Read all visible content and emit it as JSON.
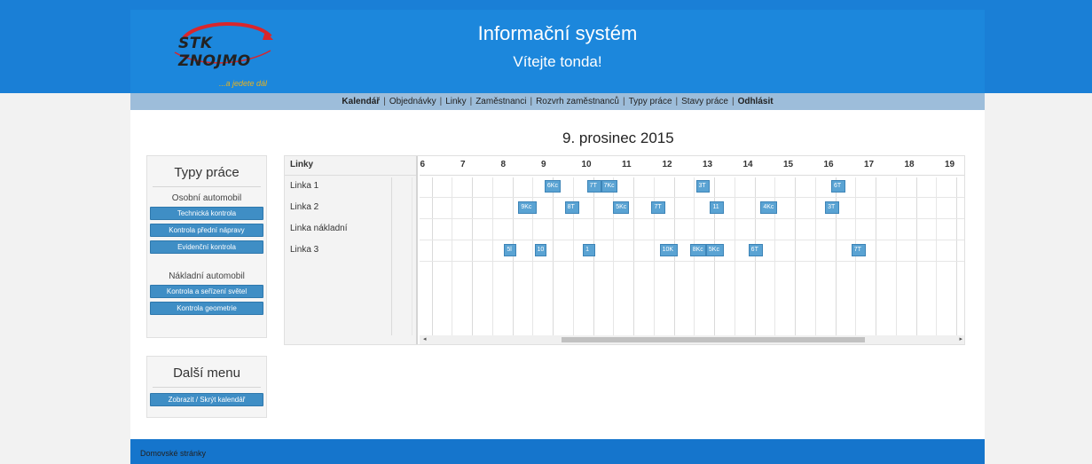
{
  "brand": {
    "name": "STK ZNOJMO",
    "tagline": "...a jedete dál"
  },
  "header": {
    "title": "Informační systém",
    "welcome": "Vítejte tonda!"
  },
  "nav": [
    {
      "label": "Kalendář",
      "bold": true
    },
    {
      "label": "Objednávky",
      "bold": false
    },
    {
      "label": "Linky",
      "bold": false
    },
    {
      "label": "Zaměstnanci",
      "bold": false
    },
    {
      "label": "Rozvrh zaměstnanců",
      "bold": false
    },
    {
      "label": "Typy práce",
      "bold": false
    },
    {
      "label": "Stavy práce",
      "bold": false
    },
    {
      "label": "Odhlásit",
      "bold": true
    }
  ],
  "sidebar": {
    "work_types": {
      "title": "Typy práce",
      "car_group": "Osobní automobil",
      "car_buttons": [
        "Technická kontrola",
        "Kontrola přední nápravy",
        "Evidenční kontrola"
      ],
      "truck_group": "Nákladní automobil",
      "truck_buttons": [
        "Kontrola a seřízení světel",
        "Kontrola geometrie"
      ]
    },
    "more_menu": {
      "title": "Další menu",
      "button": "Zobrazit / Skrýt kalendář"
    }
  },
  "calendar": {
    "date": "9. prosinec 2015",
    "column_header": "Linky",
    "lines": [
      "Linka 1",
      "Linka 2",
      "Linka nákladní",
      "Linka 3"
    ],
    "hours": [
      "6",
      "7",
      "8",
      "9",
      "10",
      "11",
      "12",
      "13",
      "14",
      "15",
      "16",
      "17",
      "18",
      "19"
    ],
    "hour_start": 6,
    "events": [
      {
        "line": 0,
        "time": 8.8,
        "duration": 0.4,
        "label": "6Kc"
      },
      {
        "line": 0,
        "time": 9.85,
        "duration": 0.35,
        "label": "7T"
      },
      {
        "line": 0,
        "time": 10.2,
        "duration": 0.4,
        "label": "7Kc"
      },
      {
        "line": 0,
        "time": 12.55,
        "duration": 0.35,
        "label": "3T"
      },
      {
        "line": 0,
        "time": 15.9,
        "duration": 0.35,
        "label": "6T"
      },
      {
        "line": 1,
        "time": 8.15,
        "duration": 0.45,
        "label": "9Kc"
      },
      {
        "line": 1,
        "time": 9.3,
        "duration": 0.35,
        "label": "8T"
      },
      {
        "line": 1,
        "time": 10.5,
        "duration": 0.4,
        "label": "5Kc"
      },
      {
        "line": 1,
        "time": 11.45,
        "duration": 0.35,
        "label": "7T"
      },
      {
        "line": 1,
        "time": 12.9,
        "duration": 0.35,
        "label": "11"
      },
      {
        "line": 1,
        "time": 14.15,
        "duration": 0.4,
        "label": "4Kc"
      },
      {
        "line": 1,
        "time": 15.75,
        "duration": 0.35,
        "label": "3T"
      },
      {
        "line": 3,
        "time": 7.8,
        "duration": 0.3,
        "label": "5l"
      },
      {
        "line": 3,
        "time": 8.55,
        "duration": 0.3,
        "label": "10"
      },
      {
        "line": 3,
        "time": 9.75,
        "duration": 0.3,
        "label": "1"
      },
      {
        "line": 3,
        "time": 11.65,
        "duration": 0.45,
        "label": "10K"
      },
      {
        "line": 3,
        "time": 12.4,
        "duration": 0.4,
        "label": "8Kc"
      },
      {
        "line": 3,
        "time": 12.8,
        "duration": 0.45,
        "label": "5Kc"
      },
      {
        "line": 3,
        "time": 13.85,
        "duration": 0.35,
        "label": "6T"
      },
      {
        "line": 3,
        "time": 16.4,
        "duration": 0.35,
        "label": "7T"
      }
    ]
  },
  "footer": {
    "link": "Domovské stránky"
  }
}
